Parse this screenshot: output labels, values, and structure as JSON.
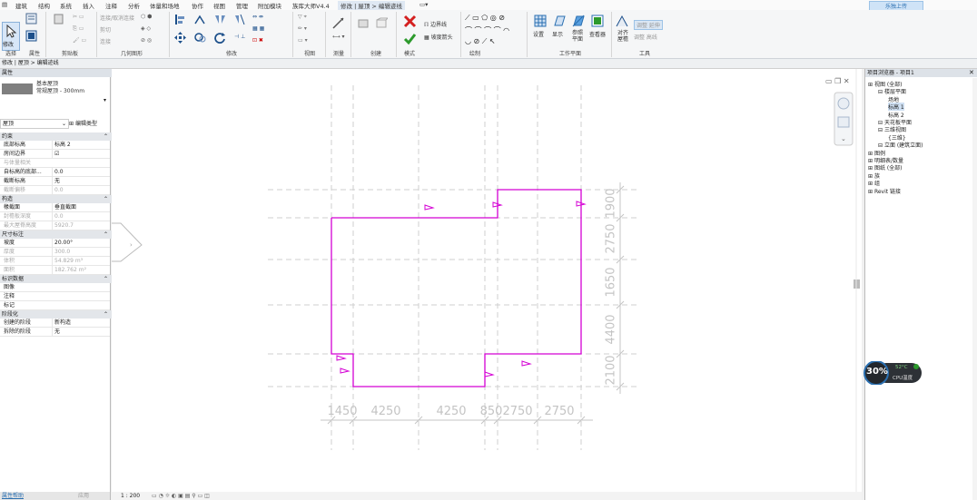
{
  "menu": [
    "建筑",
    "结构",
    "系统",
    "插入",
    "注释",
    "分析",
    "体量和场地",
    "协作",
    "视图",
    "管理",
    "附加模块",
    "族库大师V4.4",
    "修改 | 屋顶 > 编辑迹线"
  ],
  "login_label": "乐独上传",
  "ribbon": {
    "modify_label": "修改",
    "panels": [
      "选择",
      "属性",
      "剪贴板",
      "几何图形",
      "修改",
      "视图",
      "测量",
      "创建",
      "模式",
      "绘制",
      "工作平面",
      "工具"
    ],
    "mode_buttons": [
      "边界线",
      "坡度箭头"
    ],
    "workplane_buttons": [
      "设置",
      "显示",
      "参照平面",
      "查看器"
    ],
    "tools_buttons": [
      "对齐屋檐",
      "调整 延伸",
      "调整 高线"
    ],
    "geometry_buttons": [
      "连接/取消连接",
      "剪切",
      "连接"
    ]
  },
  "breadcrumb": "修改 | 屋顶 > 编辑迹线",
  "properties": {
    "title": "属性",
    "type_family": "基本屋顶",
    "type_name": "常规屋顶 - 300mm",
    "instance_dropdown": "屋顶",
    "edit_type": "编辑类型",
    "sections": [
      {
        "name": "约束",
        "rows": [
          {
            "k": "底部标高",
            "v": "标高 2",
            "grey": false
          },
          {
            "k": "房间边界",
            "v": "☑",
            "grey": false
          },
          {
            "k": "与体量相关",
            "v": "",
            "grey": true
          },
          {
            "k": "自标高的底部...",
            "v": "0.0",
            "grey": false
          },
          {
            "k": "截断标高",
            "v": "无",
            "grey": false
          },
          {
            "k": "截断偏移",
            "v": "0.0",
            "grey": true
          }
        ]
      },
      {
        "name": "构造",
        "rows": [
          {
            "k": "椽截面",
            "v": "垂直截面",
            "grey": false
          },
          {
            "k": "封檐板深度",
            "v": "0.0",
            "grey": true
          },
          {
            "k": "最大屋脊高度",
            "v": "5920.7",
            "grey": true
          }
        ]
      },
      {
        "name": "尺寸标注",
        "rows": [
          {
            "k": "坡度",
            "v": "20.00°",
            "grey": false
          },
          {
            "k": "厚度",
            "v": "300.0",
            "grey": true
          },
          {
            "k": "体积",
            "v": "54.829 m³",
            "grey": true
          },
          {
            "k": "面积",
            "v": "182.762 m²",
            "grey": true
          }
        ]
      },
      {
        "name": "标识数据",
        "rows": [
          {
            "k": "图像",
            "v": "",
            "grey": false
          },
          {
            "k": "注释",
            "v": "",
            "grey": false
          },
          {
            "k": "标记",
            "v": "",
            "grey": false
          }
        ]
      },
      {
        "name": "阶段化",
        "rows": [
          {
            "k": "创建的阶段",
            "v": "新构造",
            "grey": false
          },
          {
            "k": "拆除的阶段",
            "v": "无",
            "grey": false
          }
        ]
      }
    ],
    "help": "属性帮助",
    "apply": "应用"
  },
  "browser": {
    "title": "项目浏览器 - 项目1",
    "nodes": [
      {
        "label": "视图 (全部)",
        "indent": 0,
        "sel": false
      },
      {
        "label": "楼层平面",
        "indent": 1,
        "sel": false
      },
      {
        "label": "场地",
        "indent": 2,
        "sel": false
      },
      {
        "label": "标高 1",
        "indent": 2,
        "sel": true
      },
      {
        "label": "标高 2",
        "indent": 2,
        "sel": false
      },
      {
        "label": "天花板平面",
        "indent": 1,
        "sel": false
      },
      {
        "label": "三维视图",
        "indent": 1,
        "sel": false
      },
      {
        "label": "{三维}",
        "indent": 2,
        "sel": false
      },
      {
        "label": "立面 (建筑立面)",
        "indent": 1,
        "sel": false
      },
      {
        "label": "图例",
        "indent": 0,
        "sel": false
      },
      {
        "label": "明细表/数量",
        "indent": 0,
        "sel": false
      },
      {
        "label": "图纸 (全部)",
        "indent": 0,
        "sel": false
      },
      {
        "label": "族",
        "indent": 0,
        "sel": false
      },
      {
        "label": "组",
        "indent": 0,
        "sel": false
      },
      {
        "label": "Revit 链接",
        "indent": 0,
        "sel": false
      }
    ]
  },
  "dimensions": {
    "bottom": [
      "1450",
      "4250",
      "4250",
      "850",
      "2750",
      "2750"
    ],
    "right": [
      "1900",
      "2750",
      "1650",
      "4400",
      "2100"
    ]
  },
  "cpu": {
    "percent": "30%",
    "temp": "52°C",
    "label": "CPU温度"
  },
  "view_scale": "1 : 200",
  "colors": {
    "sketch": "#d400d4",
    "dim": "#c4c4c4",
    "accent": "#2a6fb0"
  }
}
